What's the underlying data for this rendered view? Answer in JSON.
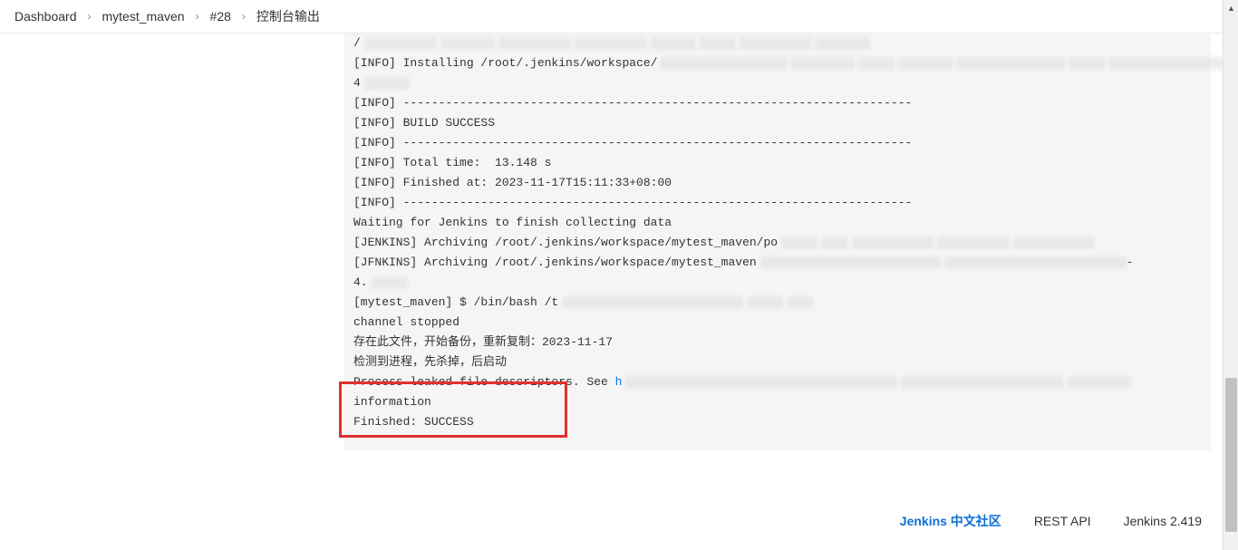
{
  "breadcrumb": {
    "items": [
      "Dashboard",
      "mytest_maven",
      "#28",
      "控制台输出"
    ],
    "sep": "›"
  },
  "console": {
    "lines": [
      {
        "type": "blur-partial",
        "prefix": "/",
        "blurs": [
          80,
          60,
          80,
          80,
          50,
          40,
          80,
          60
        ]
      },
      {
        "type": "install",
        "prefix": "[INFO] Installing /root/.jenkins/workspace/",
        "blurs": [
          140,
          70,
          40,
          60,
          120,
          40,
          190,
          40
        ]
      },
      {
        "type": "blur-only",
        "prefix": "4",
        "blurs": [
          50
        ]
      },
      {
        "type": "text",
        "text": "[INFO] ------------------------------------------------------------------------"
      },
      {
        "type": "text",
        "text": "[INFO] BUILD SUCCESS"
      },
      {
        "type": "text",
        "text": "[INFO] ------------------------------------------------------------------------"
      },
      {
        "type": "text",
        "text": "[INFO] Total time:  13.148 s"
      },
      {
        "type": "text",
        "text": "[INFO] Finished at: 2023-11-17T15:11:33+08:00"
      },
      {
        "type": "text",
        "text": "[INFO] ------------------------------------------------------------------------"
      },
      {
        "type": "text",
        "text": "Waiting for Jenkins to finish collecting data"
      },
      {
        "type": "jenkins1",
        "prefix": "[JENKINS] Archiving /root/.jenkins/workspace/mytest_maven/po",
        "blurs": [
          40,
          30,
          90,
          80,
          90
        ]
      },
      {
        "type": "jenkins2",
        "prefix": "[JFNKINS] Archiving /root/.jenkins/workspace/mytest_maven",
        "blurs": [
          200,
          200
        ],
        "suffix": "-"
      },
      {
        "type": "blur-only",
        "prefix": "4.",
        "blurs": [
          40
        ]
      },
      {
        "type": "bash",
        "prefix": "[mytest_maven] $ /bin/bash /t",
        "blurs": [
          200,
          40,
          30
        ]
      },
      {
        "type": "text",
        "text": "channel stopped"
      },
      {
        "type": "text",
        "text": "存在此文件，开始备份，重新复制：2023-11-17"
      },
      {
        "type": "text",
        "text": "检测到进程，先杀掉，后启动"
      },
      {
        "type": "leak",
        "prefix": "Process leaked file descriptors. See ",
        "linkchar": "h",
        "blurs": [
          300,
          180,
          70
        ]
      },
      {
        "type": "text",
        "text": "information"
      },
      {
        "type": "text",
        "text": "Finished: SUCCESS"
      }
    ]
  },
  "footer": {
    "link1": "Jenkins 中文社区",
    "link2": "REST API",
    "version": "Jenkins 2.419"
  }
}
